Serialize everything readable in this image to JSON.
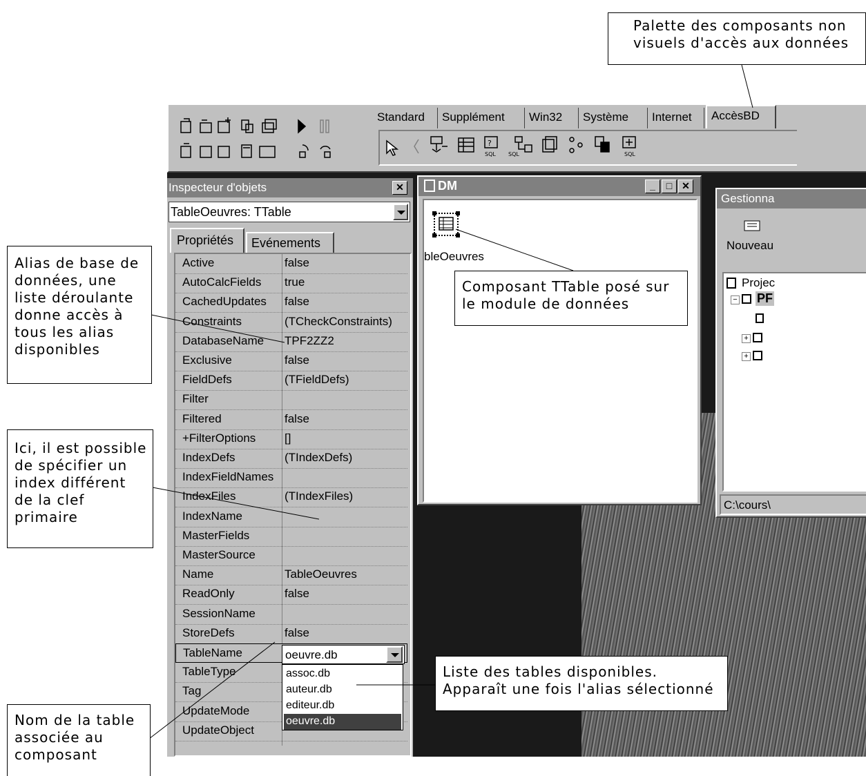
{
  "palette": {
    "tabs": [
      "Standard",
      "Supplément",
      "Win32",
      "Système",
      "Internet",
      "AccèsBD"
    ],
    "active_tab": "AccèsBD",
    "component_icons": [
      "pointer-icon",
      "datasource-icon",
      "table-icon",
      "query-icon",
      "storedproc-icon",
      "database-icon",
      "session-icon",
      "batchmove-icon",
      "updatesql-icon"
    ]
  },
  "inspector": {
    "title": "Inspecteur d'objets",
    "selected_object": "TableOeuvres: TTable",
    "tab_properties": "Propriétés",
    "tab_events": "Evénements",
    "properties": [
      {
        "name": "Active",
        "value": "false"
      },
      {
        "name": "AutoCalcFields",
        "value": "true"
      },
      {
        "name": "CachedUpdates",
        "value": "false"
      },
      {
        "name": "Constraints",
        "value": "(TCheckConstraints)"
      },
      {
        "name": "DatabaseName",
        "value": "TPF2ZZ2"
      },
      {
        "name": "Exclusive",
        "value": "false"
      },
      {
        "name": "FieldDefs",
        "value": "(TFieldDefs)"
      },
      {
        "name": "Filter",
        "value": ""
      },
      {
        "name": "Filtered",
        "value": "false"
      },
      {
        "name": "+FilterOptions",
        "value": "[]"
      },
      {
        "name": "IndexDefs",
        "value": "(TIndexDefs)"
      },
      {
        "name": "IndexFieldNames",
        "value": ""
      },
      {
        "name": "IndexFiles",
        "value": "(TIndexFiles)"
      },
      {
        "name": "IndexName",
        "value": ""
      },
      {
        "name": "MasterFields",
        "value": ""
      },
      {
        "name": "MasterSource",
        "value": ""
      },
      {
        "name": "Name",
        "value": "TableOeuvres"
      },
      {
        "name": "ReadOnly",
        "value": "false"
      },
      {
        "name": "SessionName",
        "value": ""
      },
      {
        "name": "StoreDefs",
        "value": "false"
      },
      {
        "name": "TableName",
        "value": "oeuvre.db"
      },
      {
        "name": "TableType",
        "value": ""
      },
      {
        "name": "Tag",
        "value": ""
      },
      {
        "name": "UpdateMode",
        "value": ""
      },
      {
        "name": "UpdateObject",
        "value": ""
      }
    ],
    "tablename_options": [
      "assoc.db",
      "auteur.db",
      "editeur.db",
      "oeuvre.db"
    ],
    "tablename_selected": "oeuvre.db"
  },
  "dm_window": {
    "title": "DM",
    "component_label": "bleOeuvres"
  },
  "project_manager": {
    "title": "Gestionna",
    "new_button": "Nouveau",
    "tree_root": "Projec",
    "tree_child": "PF",
    "status_path": "C:\\cours\\"
  },
  "callouts": {
    "palette": [
      "Palette des composants non",
      "visuels d'accès aux données"
    ],
    "alias": [
      "Alias de base de",
      "données, une",
      "liste déroulante",
      "donne accès à",
      "tous les alias",
      "disponibles"
    ],
    "index": [
      "Ici, il est possible",
      "de spécifier un",
      "index différent",
      "de la clef",
      "primaire"
    ],
    "tablename": [
      "Nom de la table",
      "associée au",
      "composant"
    ],
    "ttable": [
      "Composant TTable posé sur",
      "le module de données"
    ],
    "tables_list": [
      "Liste des tables disponibles.",
      "Apparaît une fois l'alias sélectionné"
    ]
  }
}
